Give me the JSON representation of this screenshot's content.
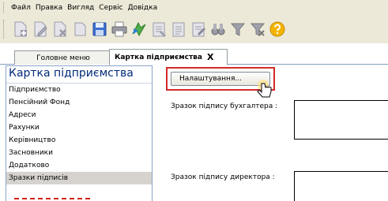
{
  "menu": {
    "items": [
      "Файл",
      "Правка",
      "Вигляд",
      "Сервіс",
      "Довідка"
    ]
  },
  "toolbar": {
    "buttons": [
      "add-icon",
      "edit-icon",
      "delete-icon",
      "copy-icon",
      "save-icon",
      "print-icon",
      "refresh-icon",
      "document-icon",
      "document-list-icon",
      "document-edit-icon",
      "binoculars-icon",
      "filter-icon",
      "clear-filter-icon",
      "help-icon"
    ]
  },
  "tabs": [
    {
      "label": "Головне меню"
    },
    {
      "label": "Картка підприємства",
      "close": "X"
    }
  ],
  "left_panel": {
    "title": "Картка підприємства",
    "items": [
      "Підприємство",
      "Пенсійний Фонд",
      "Адреси",
      "Рахунки",
      "Керівництво",
      "Засновники",
      "Додатково",
      "Зразки підписів"
    ],
    "selected_index": 7
  },
  "right_panel": {
    "settings_button": "Налаштування...",
    "accountant_label": "Зразок підпису бухгалтера :",
    "director_label": "Зразок підпису директора :"
  },
  "colors": {
    "chrome": "#ece9d8",
    "panel_title": "#002a7a",
    "highlight_red": "#d42a2a",
    "selected_bg": "#d6d3ce"
  }
}
